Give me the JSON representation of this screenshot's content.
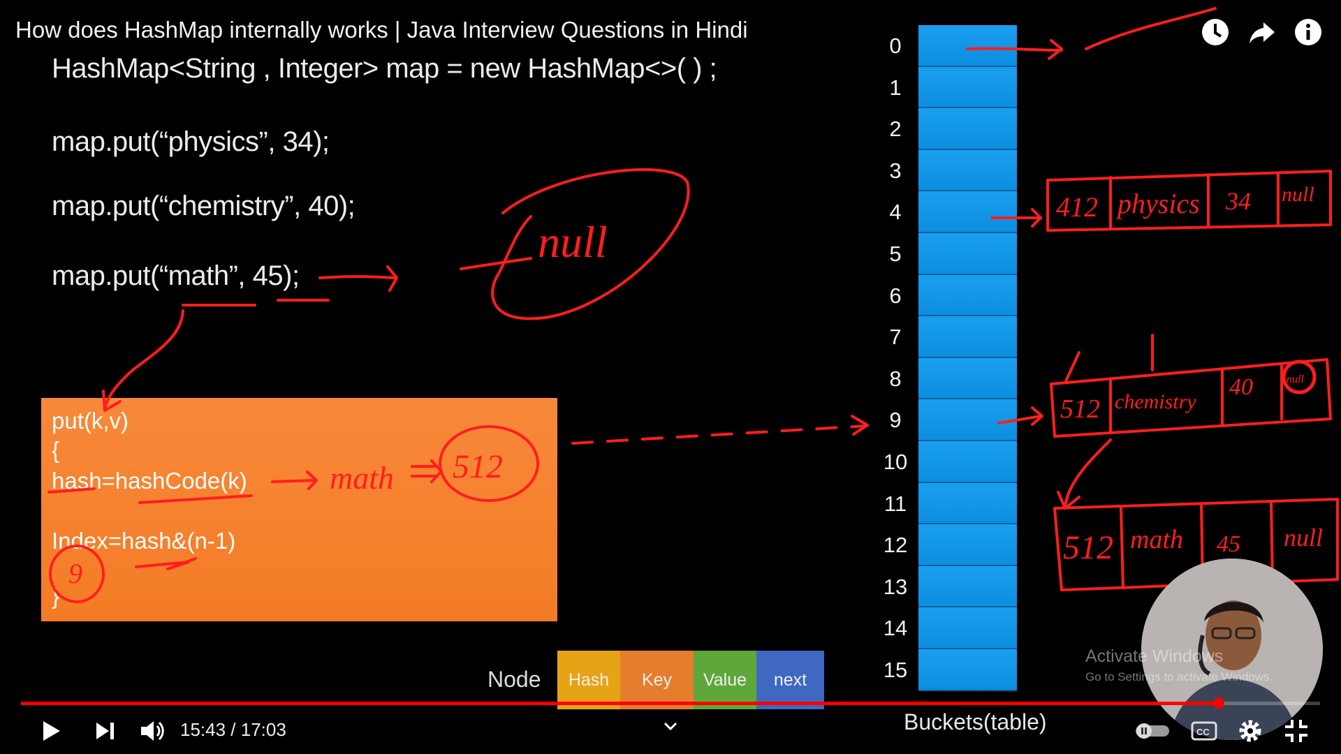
{
  "header": {
    "title": "How does HashMap internally works | Java Interview Questions in Hindi"
  },
  "code": {
    "declaration": "HashMap<String , Integer> map = new HashMap<>( ) ;",
    "put1": "map.put(“physics”, 34);",
    "put2": "map.put(“chemistry”, 40);",
    "put3": "map.put(“math”, 45);"
  },
  "put_box": {
    "line1": "put(k,v)",
    "line2": "{",
    "line3": "hash=hashCode(k)",
    "line4": "Index=hash&(n-1)",
    "line5": "}"
  },
  "node": {
    "label": "Node",
    "cells": [
      {
        "label": "Hash",
        "color": "#e6a315"
      },
      {
        "label": "Key",
        "color": "#e57d2c"
      },
      {
        "label": "Value",
        "color": "#5fa73b"
      },
      {
        "label": "next",
        "color": "#3f68c2"
      }
    ]
  },
  "buckets": {
    "caption": "Buckets(table)",
    "indices": [
      "0",
      "1",
      "2",
      "3",
      "4",
      "5",
      "6",
      "7",
      "8",
      "9",
      "10",
      "11",
      "12",
      "13",
      "14",
      "15"
    ],
    "color": "#1a9ff0"
  },
  "annotations": {
    "null_bubble": "null",
    "math_arrow": "math",
    "hash_value": "512",
    "index_value": "9",
    "nodes": [
      {
        "hash": "412",
        "key": "physics",
        "value": "34",
        "next": "null"
      },
      {
        "hash": "512",
        "key": "chemistry",
        "value": "40",
        "next": "null"
      },
      {
        "hash": "512",
        "key": "math",
        "value": "45",
        "next": "null"
      }
    ],
    "ink_color": "#ff1e1e"
  },
  "top_icons": [
    "clock-icon",
    "share-icon",
    "info-icon"
  ],
  "player": {
    "time": "15:43 / 17:03",
    "progress_fraction": 0.922,
    "accent": "#ff0000"
  },
  "watermark": {
    "line1": "Activate Windows",
    "line2": "Go to Settings to activate Windows."
  }
}
